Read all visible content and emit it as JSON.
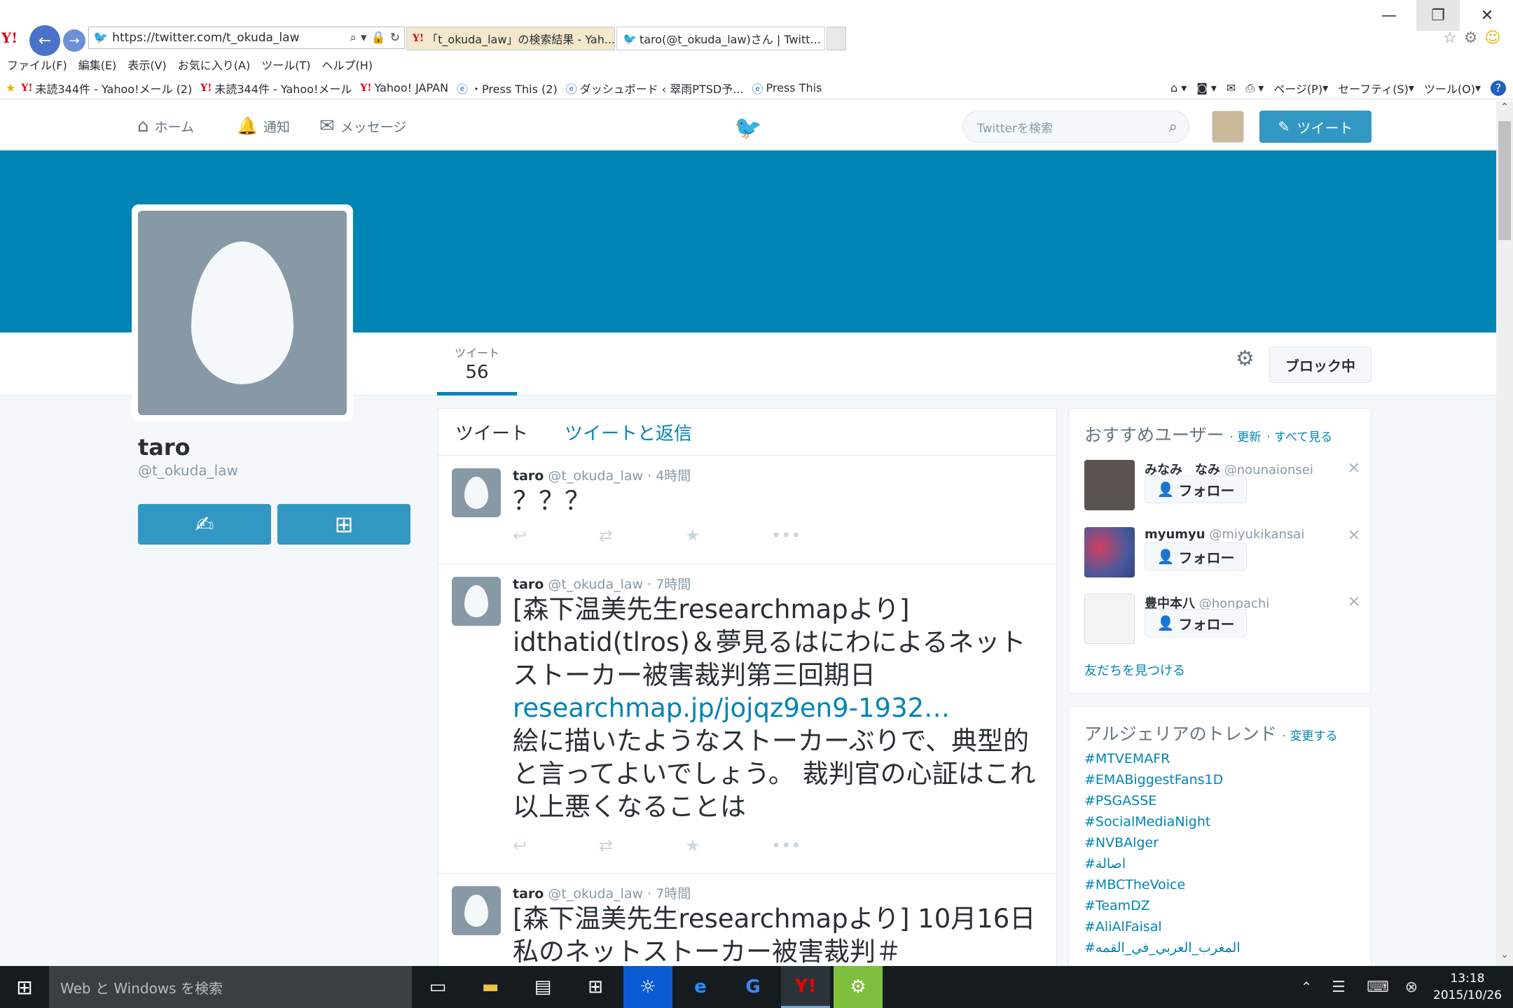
{
  "browser": {
    "address": "https://twitter.com/t_okuda_law",
    "tabs": [
      {
        "title": "「t_okuda_law」の検索結果 - Yah...",
        "active": false
      },
      {
        "title": "taro(@t_okuda_law)さん | Twitt...",
        "active": true
      }
    ],
    "menu": [
      "ファイル(F)",
      "編集(E)",
      "表示(V)",
      "お気に入り(A)",
      "ツール(T)",
      "ヘルプ(H)"
    ],
    "favorites": [
      "未読344件 - Yahoo!メール (2)",
      "未読344件 - Yahoo!メール",
      "Yahoo! JAPAN",
      "・Press This (2)",
      "ダッシュボード ‹ 翠雨PTSD予...",
      "Press This"
    ],
    "commands": [
      "ページ(P)",
      "セーフティ(S)",
      "ツール(O)"
    ]
  },
  "twitter_nav": {
    "home": "ホーム",
    "notifications": "通知",
    "messages": "メッセージ",
    "search_placeholder": "Twitterを検索",
    "tweet_button": "ツイート"
  },
  "profile": {
    "name": "taro",
    "handle": "@t_okuda_law",
    "stats": {
      "label": "ツイート",
      "value": "56"
    },
    "block_button": "ブロック中"
  },
  "timeline": {
    "tabs": [
      "ツイート",
      "ツイートと返信"
    ],
    "tweets": [
      {
        "name": "taro",
        "handle": "@t_okuda_law",
        "time": "· 4時間",
        "text": "？？？",
        "link": "",
        "after": ""
      },
      {
        "name": "taro",
        "handle": "@t_okuda_law",
        "time": "· 7時間",
        "text": "[森下温美先生researchmapより] idthatid(tlros)＆夢見るはにわによるネットストーカー被害裁判第三回期日",
        "link": "researchmap.jp/jojqz9en9-1932…",
        "after": "絵に描いたようなストーカーぶりで、典型的と言ってよいでしょう。 裁判官の心証はこれ以上悪くなることは"
      },
      {
        "name": "taro",
        "handle": "@t_okuda_law",
        "time": "· 7時間",
        "text": "[森下温美先生researchmapより] 10月16日私のネットストーカー被害裁判＃",
        "link": "",
        "after": ""
      }
    ]
  },
  "suggestions": {
    "title": "おすすめユーザー",
    "refresh": "· 更新",
    "view_all": "· すべて見る",
    "follow_label": "フォロー",
    "users": [
      {
        "name": "みなみ　なみ",
        "handle": "@nounaionsei",
        "color": "#5a5350"
      },
      {
        "name": "myumyu",
        "handle": "@miyukikansai",
        "color": "#8a3a5c"
      },
      {
        "name": "豊中本八",
        "handle": "@honpachi",
        "color": "#e8e8e8"
      }
    ],
    "find_friends": "友だちを見つける"
  },
  "trends": {
    "title": "アルジェリアのトレンド",
    "change": "· 変更する",
    "items": [
      "#MTVEMAFR",
      "#EMABiggestFans1D",
      "#PSGASSE",
      "#SocialMediaNight",
      "#NVBAlger",
      "#اصالة",
      "#MBCTheVoice",
      "#TeamDZ",
      "#AliAlFaisal",
      "#المغرب_العربي_في_القمه"
    ]
  },
  "taskbar": {
    "search_placeholder": "Web と Windows を検索",
    "time": "13:18",
    "date": "2015/10/26"
  },
  "colors": {
    "twitter_blue": "#0084b4",
    "button_blue": "#3397c4",
    "egg_gray": "#8899a6"
  }
}
